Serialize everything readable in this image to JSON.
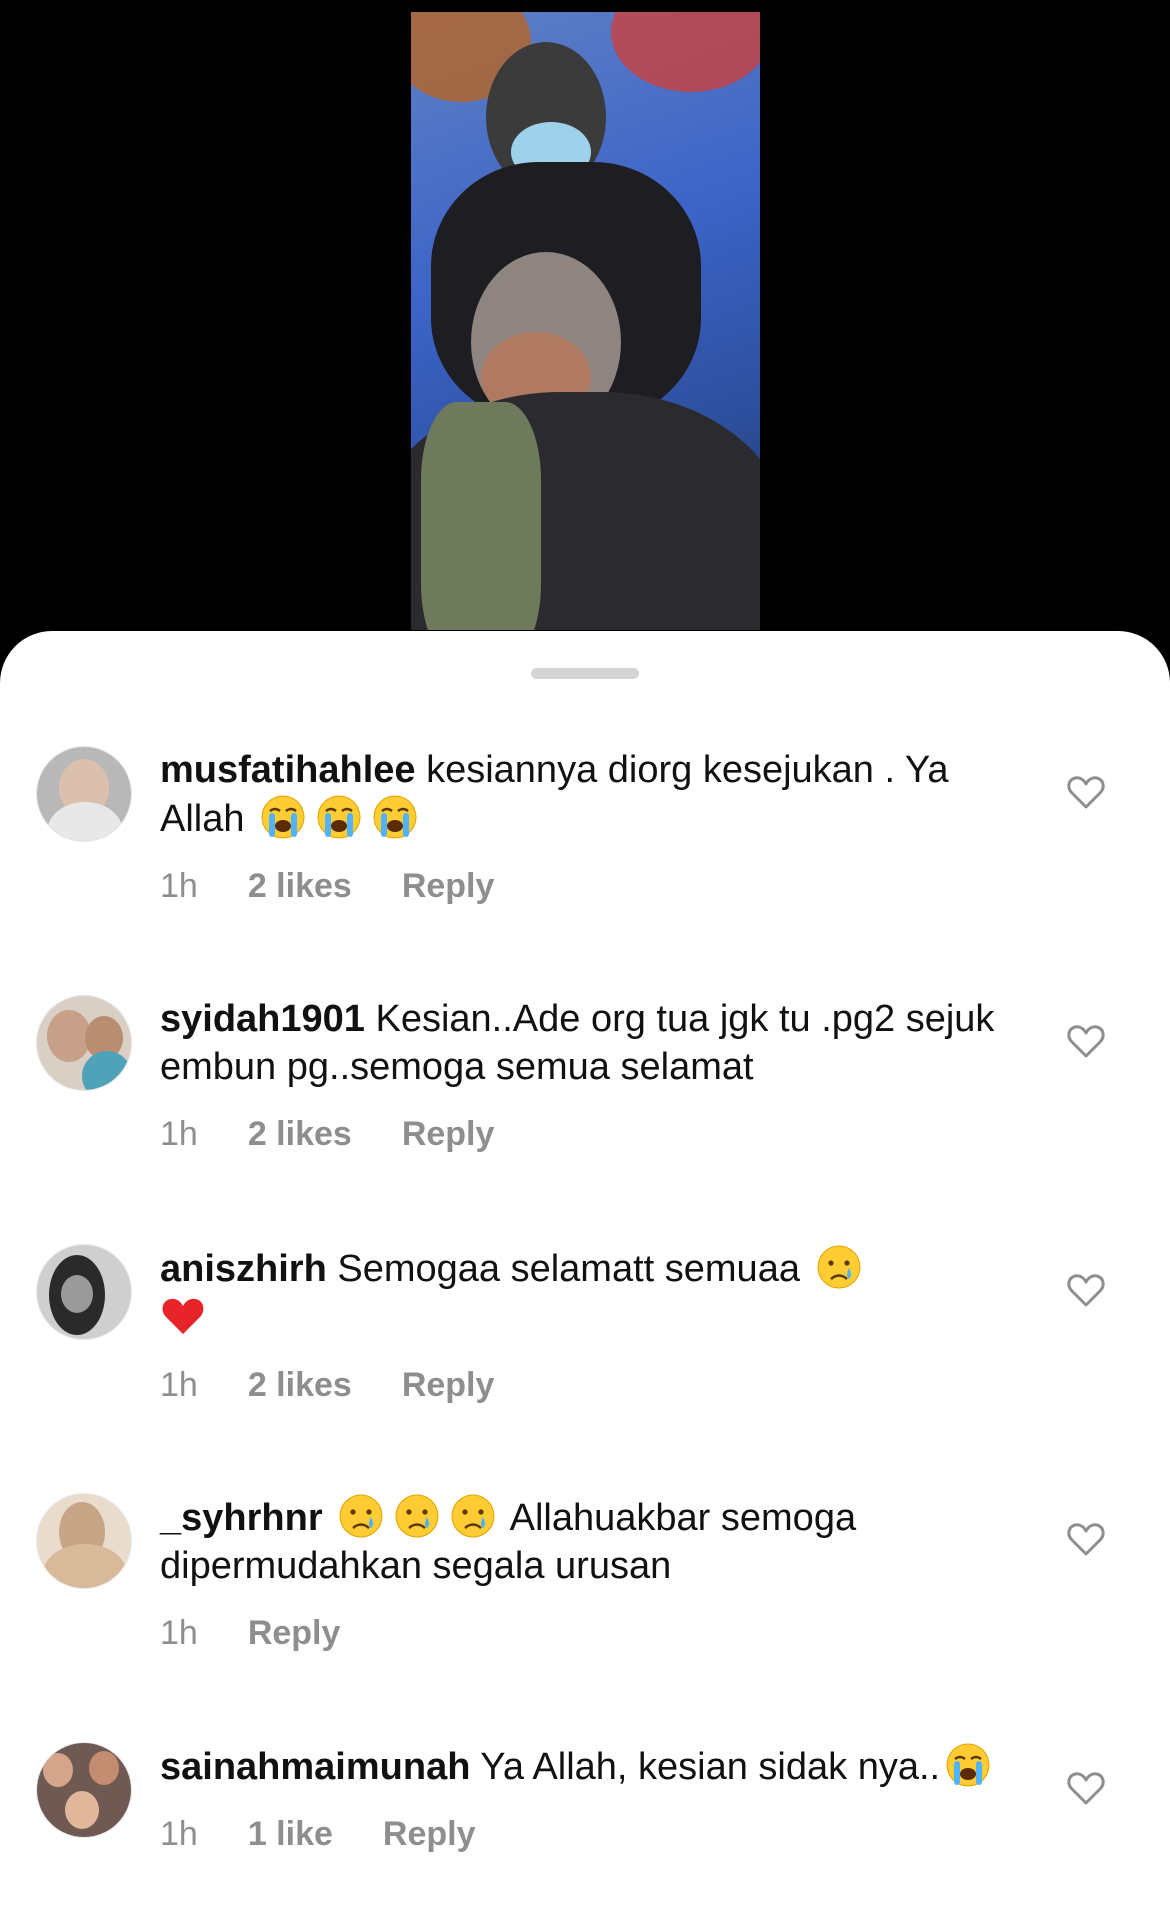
{
  "colors": {
    "sheet_bg": "#ffffff",
    "text": "#111111",
    "meta": "#8e8e8e",
    "grabber": "#d4d4d4",
    "heart_outline": "#8e8e8e"
  },
  "comments": [
    {
      "username": "musfatihahlee",
      "text_before": " kesiannya diorg kesejukan . Ya Allah ",
      "emoji": [
        "loudly-crying-face",
        "loudly-crying-face",
        "loudly-crying-face"
      ],
      "text_after": "",
      "time": "1h",
      "likes": "2 likes",
      "reply": "Reply"
    },
    {
      "username": "syidah1901",
      "text_before": " Kesian..Ade org tua jgk tu .pg2 sejuk embun pg..semoga semua selamat",
      "emoji": [],
      "text_after": "",
      "time": "1h",
      "likes": "2 likes",
      "reply": "Reply"
    },
    {
      "username": "aniszhirh",
      "text_before": " Semogaa selamatt semuaa ",
      "emoji": [
        "crying-face",
        "red-heart"
      ],
      "text_after": "",
      "time": "1h",
      "likes": "2 likes",
      "reply": "Reply"
    },
    {
      "username": "_syhrhnr",
      "text_before": " ",
      "emoji": [
        "crying-face",
        "crying-face",
        "crying-face"
      ],
      "text_after": " Allahuakbar semoga dipermudahkan segala urusan",
      "time": "1h",
      "likes": "",
      "reply": "Reply"
    },
    {
      "username": "sainahmaimunah",
      "text_before": " Ya Allah, kesian sidak nya..",
      "emoji": [
        "loudly-crying-face"
      ],
      "text_after": "",
      "time": "1h",
      "likes": "1 like",
      "reply": "Reply"
    }
  ],
  "icons": {
    "like": "heart-outline-icon",
    "grabber": "sheet-grabber"
  }
}
